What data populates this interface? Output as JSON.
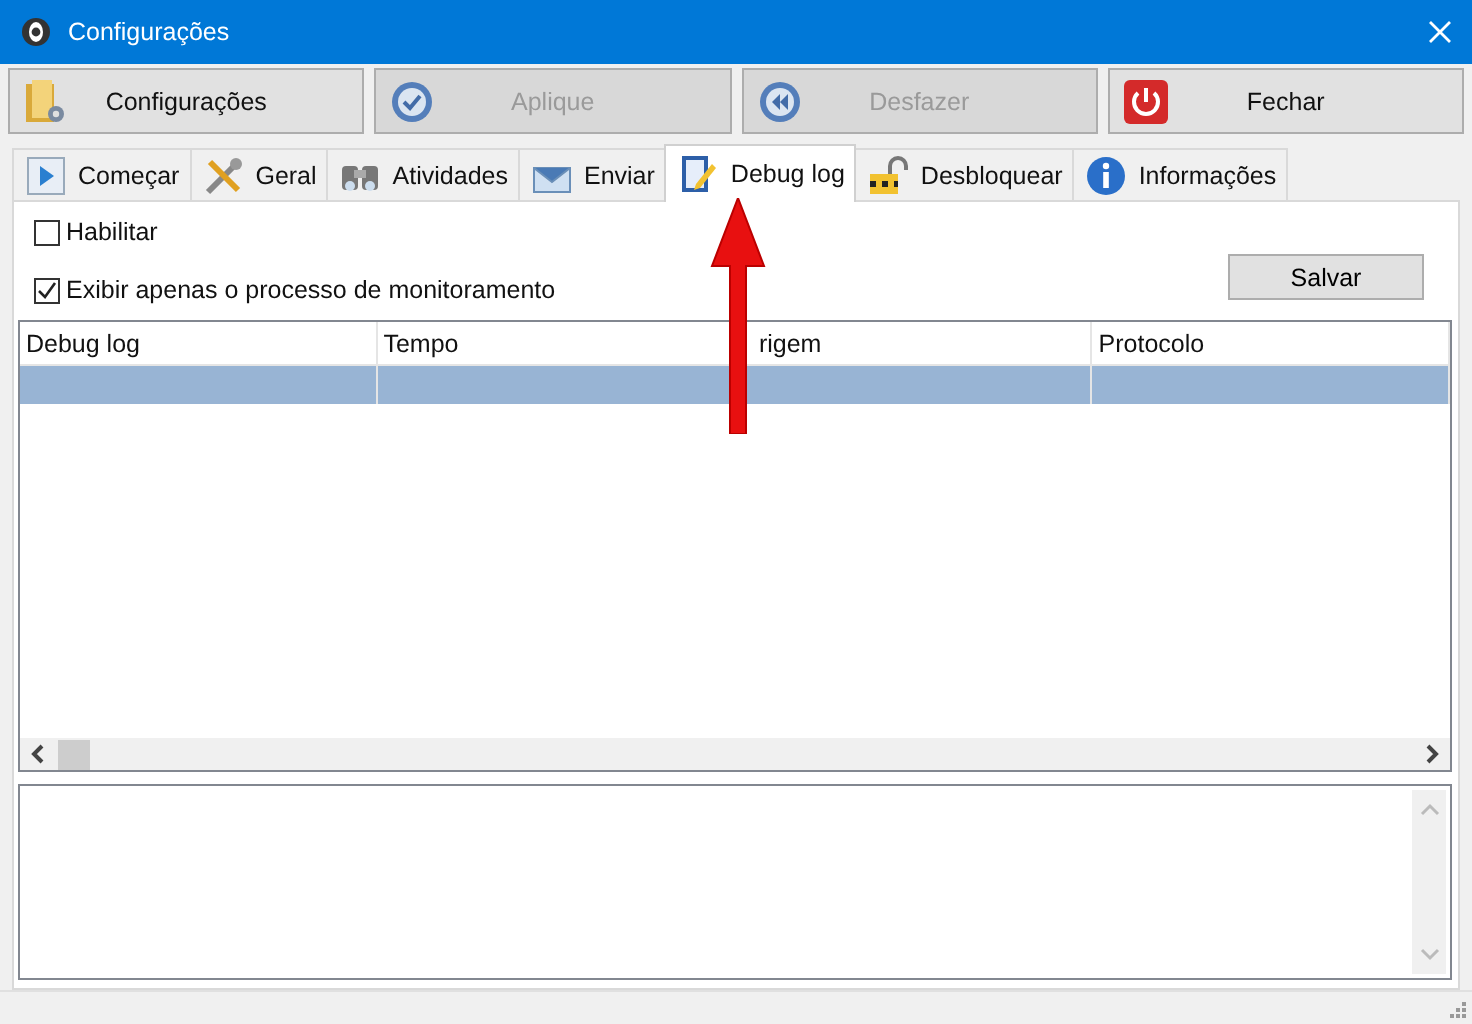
{
  "window": {
    "title": "Configurações"
  },
  "toolbar": [
    {
      "label": "Configurações",
      "disabled": false
    },
    {
      "label": "Aplique",
      "disabled": true
    },
    {
      "label": "Desfazer",
      "disabled": true
    },
    {
      "label": "Fechar",
      "disabled": false
    }
  ],
  "tabs": [
    {
      "label": "Começar",
      "selected": false
    },
    {
      "label": "Geral",
      "selected": false
    },
    {
      "label": "Atividades",
      "selected": false
    },
    {
      "label": "Enviar",
      "selected": false
    },
    {
      "label": "Debug log",
      "selected": true
    },
    {
      "label": "Desbloquear",
      "selected": false
    },
    {
      "label": "Informações",
      "selected": false
    }
  ],
  "options": [
    {
      "label": "Habilitar",
      "checked": false
    },
    {
      "label": "Exibir apenas o processo de monitoramento",
      "checked": true
    }
  ],
  "save_button": "Salvar",
  "table": {
    "columns": [
      "Debug log",
      "Tempo",
      "rigem",
      "Protocolo"
    ],
    "rows": [
      {
        "selected": true
      }
    ]
  }
}
